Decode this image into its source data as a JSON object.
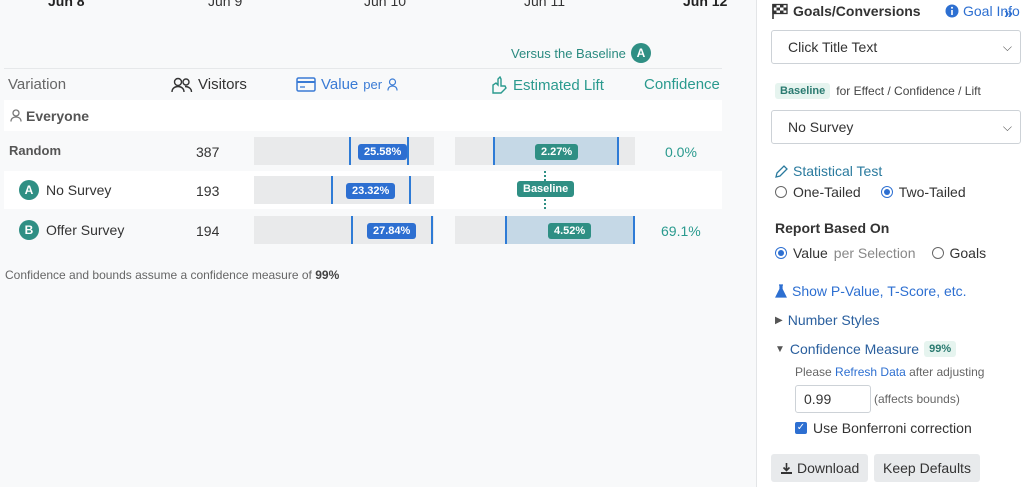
{
  "timeline": {
    "dates": [
      {
        "label": "Jun 8",
        "bold": true
      },
      {
        "label": "Jun 9",
        "bold": false
      },
      {
        "label": "Jun 10",
        "bold": false
      },
      {
        "label": "Jun 11",
        "bold": false
      },
      {
        "label": "Jun 12",
        "bold": true
      }
    ]
  },
  "versus": {
    "label": "Versus the Baseline",
    "badge": "A"
  },
  "table": {
    "headers": {
      "variation": "Variation",
      "visitors": "Visitors",
      "value": "Value",
      "value_per": "per",
      "lift": "Estimated Lift",
      "confidence": "Confidence"
    },
    "segment": "Everyone",
    "rows": [
      {
        "badge": "",
        "name": "Random",
        "visitors": "387",
        "value": "25.58%",
        "lift": "2.27%",
        "confidence": "0.0%"
      },
      {
        "badge": "A",
        "name": "No Survey",
        "visitors": "193",
        "value": "23.32%",
        "lift": "Baseline",
        "confidence": ""
      },
      {
        "badge": "B",
        "name": "Offer Survey",
        "visitors": "194",
        "value": "27.84%",
        "lift": "4.52%",
        "confidence": "69.1%"
      }
    ]
  },
  "footnote": {
    "text": "Confidence and bounds assume a confidence measure of",
    "value": "99%"
  },
  "sidebar": {
    "goals_title": "Goals/Conversions",
    "goal_info": "Goal Info",
    "goal_select": "Click Title Text",
    "baseline_tag": "Baseline",
    "baseline_text": "for Effect / Confidence / Lift",
    "baseline_select": "No Survey",
    "stat_test_label": "Statistical Test",
    "one_tailed": "One-Tailed",
    "two_tailed": "Two-Tailed",
    "report_heading": "Report Based On",
    "value_option": "Value",
    "value_option_muted": "per Selection",
    "goals_option": "Goals",
    "show_pvalue": "Show P-Value, T-Score, etc.",
    "number_styles": "Number Styles",
    "conf_measure": "Confidence Measure",
    "conf_measure_tag": "99%",
    "please": "Please",
    "refresh_link": "Refresh Data",
    "after": "after adjusting",
    "conf_input": "0.99",
    "affects": "(affects bounds)",
    "bonferroni": "Use Bonferroni correction",
    "download": "Download",
    "keep_defaults": "Keep Defaults"
  },
  "colors": {
    "accent_blue": "#2d6fd1",
    "accent_teal": "#2f8f84"
  }
}
